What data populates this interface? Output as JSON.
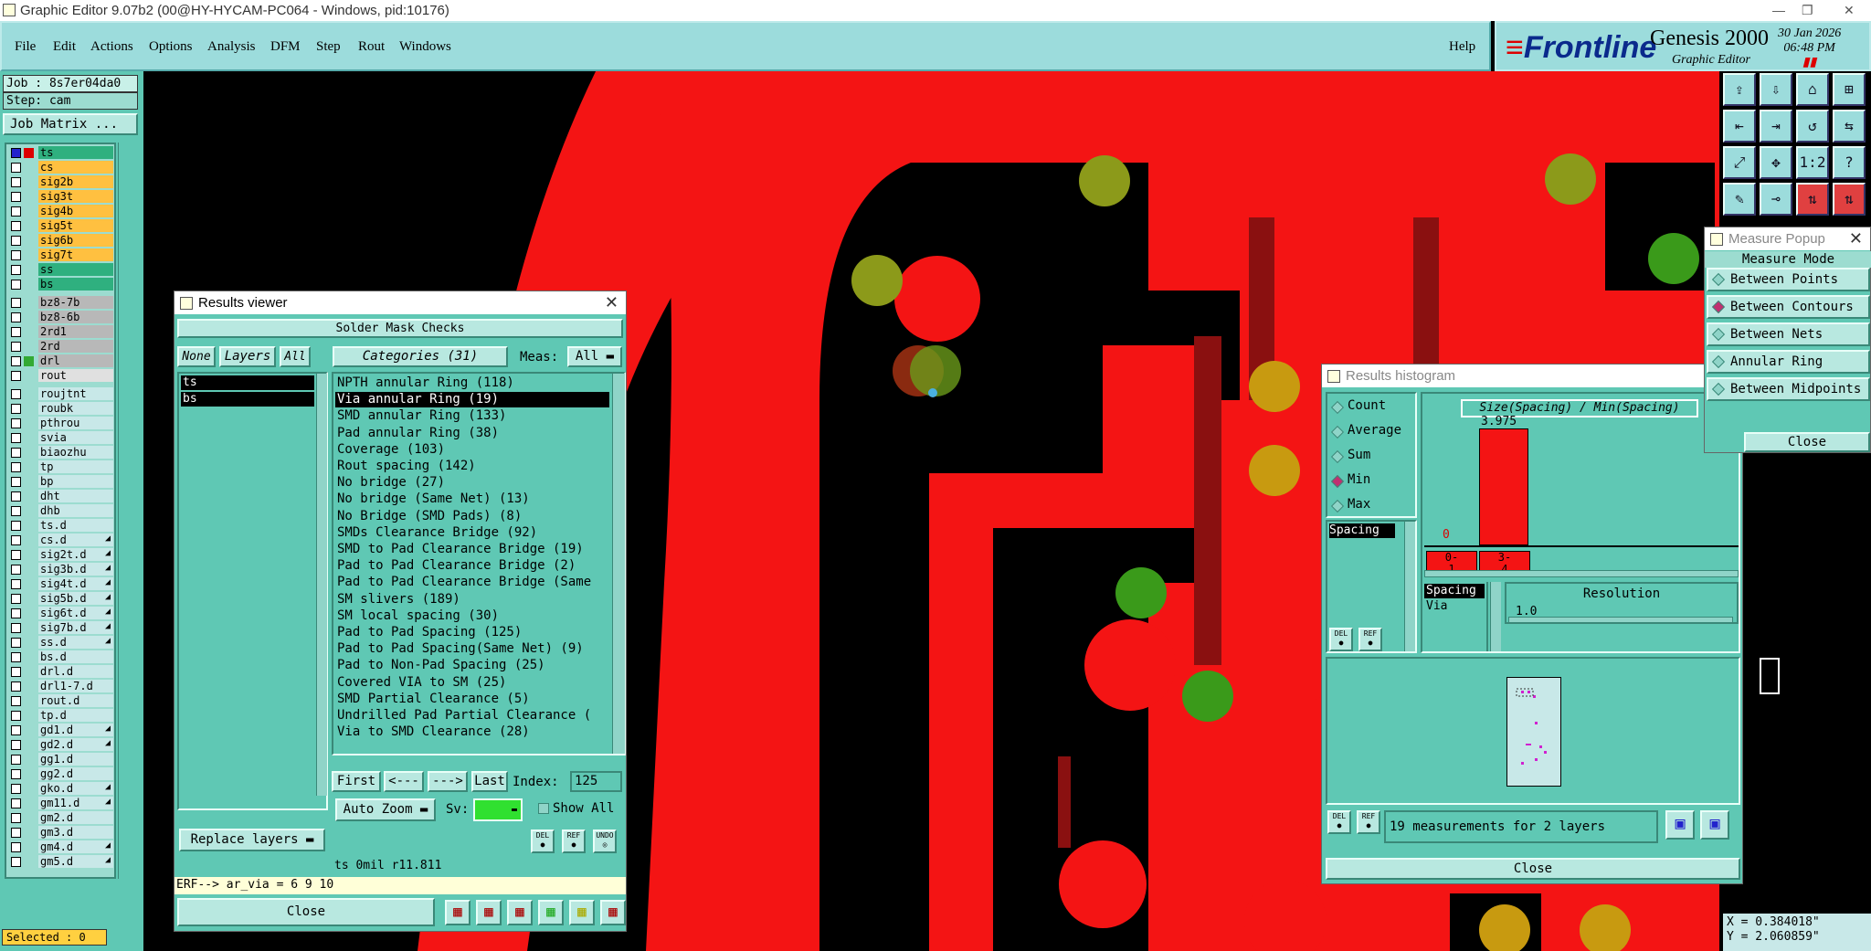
{
  "titlebar": {
    "title": "Graphic Editor 9.07b2 (00@HY-HYCAM-PC064 - Windows, pid:10176)",
    "min": "—",
    "max": "❐",
    "close": "✕"
  },
  "menu": {
    "items": [
      "File",
      "Edit",
      "Actions",
      "Options",
      "Analysis",
      "DFM",
      "Step",
      "Rout",
      "Windows"
    ],
    "help": "Help"
  },
  "brand": {
    "logo_a": "≡",
    "logo_b": "Frontline",
    "product": "Genesis 2000",
    "subtitle": "Graphic Editor",
    "date": "30 Jan 2026",
    "time": "06:48 PM"
  },
  "left": {
    "job": "Job : 8s7er04da0",
    "step": "Step: cam",
    "job_matrix": "Job Matrix ...",
    "selected": "Selected : 0"
  },
  "layers": [
    {
      "name": "ts",
      "color": "#2fb07f",
      "dot": "#d00",
      "first": true
    },
    {
      "name": "cs",
      "color": "#ffc040"
    },
    {
      "name": "sig2b",
      "color": "#ffc040"
    },
    {
      "name": "sig3t",
      "color": "#ffc040"
    },
    {
      "name": "sig4b",
      "color": "#ffc040"
    },
    {
      "name": "sig5t",
      "color": "#ffc040"
    },
    {
      "name": "sig6b",
      "color": "#ffc040"
    },
    {
      "name": "sig7t",
      "color": "#ffc040"
    },
    {
      "name": "ss",
      "color": "#2fb07f"
    },
    {
      "name": "bs",
      "color": "#2fb07f",
      "sep": true
    },
    {
      "name": "bz8-7b",
      "color": "#b8b8b8"
    },
    {
      "name": "bz8-6b",
      "color": "#b8b8b8"
    },
    {
      "name": "2rd1",
      "color": "#b8b8b8"
    },
    {
      "name": "2rd",
      "color": "#b8b8b8"
    },
    {
      "name": "drl",
      "color": "#b8b8b8",
      "dot": "#3a3"
    },
    {
      "name": "rout",
      "color": "#e0e0e0",
      "sep": true
    },
    {
      "name": "roujtnt",
      "color": "#c8e8e8"
    },
    {
      "name": "roubk",
      "color": "#c8e8e8"
    },
    {
      "name": "pthrou",
      "color": "#c8e8e8"
    },
    {
      "name": "svia",
      "color": "#c8e8e8"
    },
    {
      "name": "biaozhu",
      "color": "#c8e8e8"
    },
    {
      "name": "tp",
      "color": "#c8e8e8"
    },
    {
      "name": "bp",
      "color": "#c8e8e8"
    },
    {
      "name": "dht",
      "color": "#c8e8e8"
    },
    {
      "name": "dhb",
      "color": "#c8e8e8"
    },
    {
      "name": "ts.d",
      "color": "#c8e8e8"
    },
    {
      "name": "cs.d",
      "color": "#c8e8e8",
      "mark": "◢"
    },
    {
      "name": "sig2t.d",
      "color": "#c8e8e8",
      "mark": "◢"
    },
    {
      "name": "sig3b.d",
      "color": "#c8e8e8",
      "mark": "◢"
    },
    {
      "name": "sig4t.d",
      "color": "#c8e8e8",
      "mark": "◢"
    },
    {
      "name": "sig5b.d",
      "color": "#c8e8e8",
      "mark": "◢"
    },
    {
      "name": "sig6t.d",
      "color": "#c8e8e8",
      "mark": "◢"
    },
    {
      "name": "sig7b.d",
      "color": "#c8e8e8",
      "mark": "◢"
    },
    {
      "name": "ss.d",
      "color": "#c8e8e8",
      "mark": "◢"
    },
    {
      "name": "bs.d",
      "color": "#c8e8e8"
    },
    {
      "name": "drl.d",
      "color": "#c8e8e8"
    },
    {
      "name": "drl1-7.d",
      "color": "#c8e8e8"
    },
    {
      "name": "rout.d",
      "color": "#c8e8e8"
    },
    {
      "name": "tp.d",
      "color": "#c8e8e8"
    },
    {
      "name": "gd1.d",
      "color": "#c8e8e8",
      "mark": "◢"
    },
    {
      "name": "gd2.d",
      "color": "#c8e8e8",
      "mark": "◢"
    },
    {
      "name": "gg1.d",
      "color": "#c8e8e8"
    },
    {
      "name": "gg2.d",
      "color": "#c8e8e8"
    },
    {
      "name": "gko.d",
      "color": "#c8e8e8",
      "mark": "◢"
    },
    {
      "name": "gm11.d",
      "color": "#c8e8e8",
      "mark": "◢"
    },
    {
      "name": "gm2.d",
      "color": "#c8e8e8"
    },
    {
      "name": "gm3.d",
      "color": "#c8e8e8"
    },
    {
      "name": "gm4.d",
      "color": "#c8e8e8",
      "mark": "◢"
    },
    {
      "name": "gm5.d",
      "color": "#c8e8e8",
      "mark": "◢"
    }
  ],
  "results": {
    "title": "Results viewer",
    "header": "Solder Mask Checks",
    "none": "None",
    "layers_btn": "Layers",
    "all": "All",
    "categories_btn": "Categories (31)",
    "meas_label": "Meas:",
    "meas_value": "All",
    "layer_items": [
      "ts",
      "bs"
    ],
    "categories": [
      "NPTH annular Ring (118)",
      "Via annular Ring (19)",
      "SMD annular Ring (133)",
      "Pad annular Ring (38)",
      "Coverage (103)",
      "Rout spacing (142)",
      "No bridge (27)",
      "No bridge (Same Net) (13)",
      "No Bridge (SMD Pads) (8)",
      "SMDs Clearance Bridge (92)",
      "SMD to Pad Clearance Bridge (19)",
      "Pad to Pad Clearance Bridge (2)",
      "Pad to Pad Clearance Bridge (Same",
      "SM slivers (189)",
      "SM local spacing (30)",
      "Pad to Pad Spacing (125)",
      "Pad to Pad Spacing(Same Net) (9)",
      "Pad to Non-Pad Spacing (25)",
      "Covered VIA to SM (25)",
      "SMD Partial Clearance (5)",
      "Undrilled Pad Partial Clearance (",
      "Via to SMD Clearance (28)"
    ],
    "selected_index": 1,
    "first": "First",
    "prev": "<---",
    "next": "--->",
    "last": "Last",
    "index_label": "Index:",
    "index_value": "125",
    "autozoom": "Auto Zoom",
    "sv": "Sv:",
    "show_all": "Show All",
    "replace": "Replace layers",
    "del": "DEL",
    "ref": "REF",
    "undo": "UNDO",
    "status": "ts 0mil  r11.811",
    "erf": "ERF--> ar_via = 6 9 10",
    "close": "Close"
  },
  "histogram": {
    "title": "Results histogram",
    "options": [
      "Count",
      "Average",
      "Sum",
      "Min",
      "Max"
    ],
    "selected_option": "Min",
    "chart_title": "Size(Spacing) / Min(Spacing)",
    "bar_label": "3.975",
    "zero_label": "0",
    "bins": [
      "0-\n1",
      "3-\n4"
    ],
    "bar_fraction": 1.0,
    "list_label": "Spacing",
    "sizes": [
      "Spacing",
      "Via"
    ],
    "resolution_label": "Resolution",
    "resolution_value": "1.0",
    "footer": "19 measurements for 2 layers",
    "close": "Close",
    "del": "DEL",
    "ref": "REF"
  },
  "measure": {
    "title": "Measure Popup",
    "mode": "Measure Mode",
    "items": [
      "Between Points",
      "Between Contours",
      "Between Nets",
      "Annular Ring",
      "Between Midpoints"
    ],
    "selected": "Between Contours",
    "close": "Close"
  },
  "coords": {
    "x": "X = 0.384018\"",
    "y": "Y = 2.060859\""
  }
}
